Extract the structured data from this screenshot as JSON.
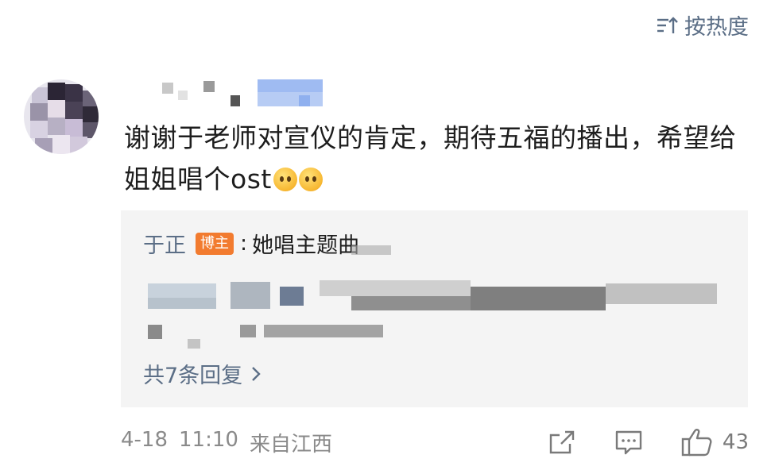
{
  "sort": {
    "label": "按热度"
  },
  "comment": {
    "text": "谢谢于老师对宣仪的肯定，期待五福的播出，希望给姐姐唱个ost",
    "emojis": [
      "smiling-face-emoji",
      "hugging-face-emoji"
    ]
  },
  "reply": {
    "author": "于正",
    "badge": "博主",
    "separator": ":",
    "text": "她唱主题曲",
    "more_label": "共7条回复"
  },
  "footer": {
    "date": "4-18",
    "time": "11:10",
    "location": "来自江西",
    "like_count": "43"
  },
  "colors": {
    "link": "#5b6e86",
    "badge": "#f27b2f",
    "reply_bg": "#f4f4f4",
    "meta": "#8a8a8a"
  }
}
